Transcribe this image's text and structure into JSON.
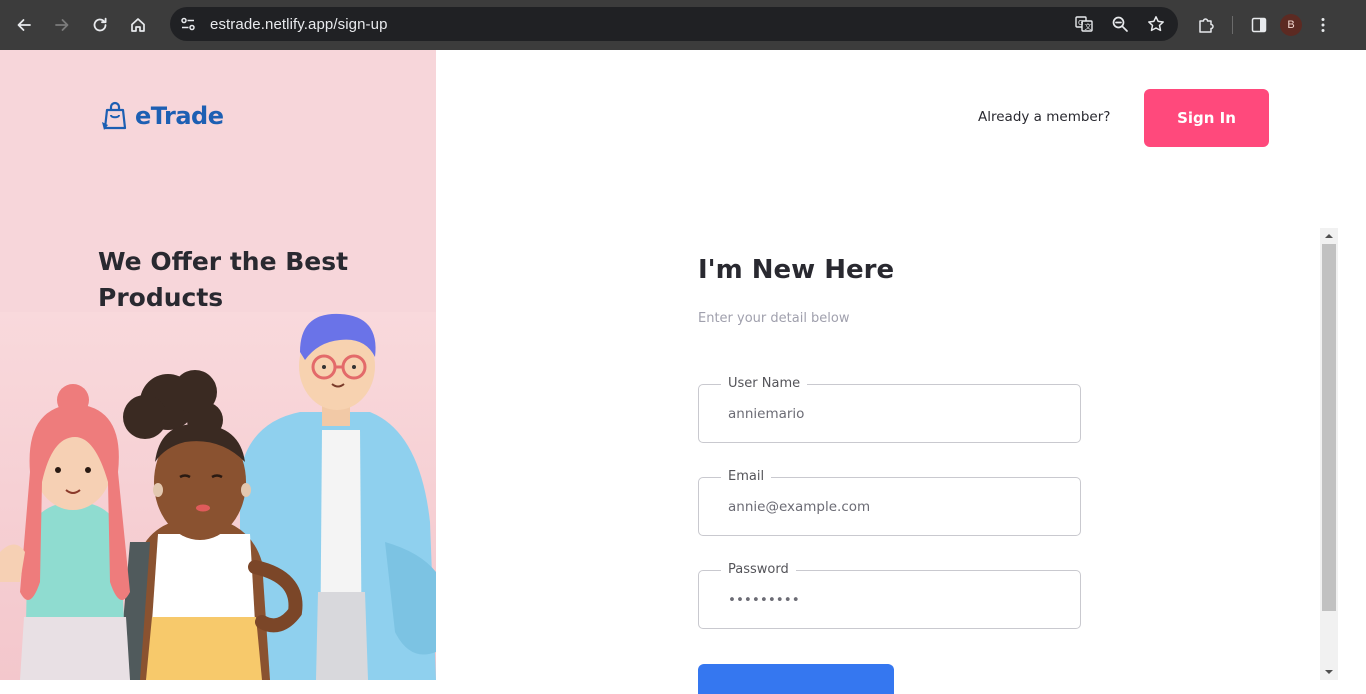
{
  "browser": {
    "url": "estrade.netlify.app/sign-up",
    "profile_initial": "B",
    "icons": [
      "back-icon",
      "forward-icon",
      "reload-icon",
      "home-icon",
      "site-info-icon",
      "translate-icon",
      "zoom-icon",
      "bookmark-star-icon",
      "extensions-icon",
      "side-panel-icon",
      "profile-avatar",
      "more-menu-icon"
    ]
  },
  "brand": {
    "name": "eTrade",
    "color": "#1d5fb3",
    "logo_icon": "shopping-bag-icon"
  },
  "left_panel": {
    "background": "#f7d6da",
    "heading": "We Offer the Best Products",
    "illustration": "three-characters-illustration"
  },
  "header": {
    "member_text": "Already a member?",
    "signin_label": "Sign In",
    "signin_color": "#ff497c"
  },
  "form": {
    "title": "I'm New Here",
    "subtitle": "Enter your detail below",
    "fields": [
      {
        "label": "User Name",
        "value": "anniemario",
        "type": "text"
      },
      {
        "label": "Email",
        "value": "annie@example.com",
        "type": "email"
      },
      {
        "label": "Password",
        "value": "•••••••••",
        "type": "password"
      }
    ],
    "submit_color": "#3577f0"
  }
}
